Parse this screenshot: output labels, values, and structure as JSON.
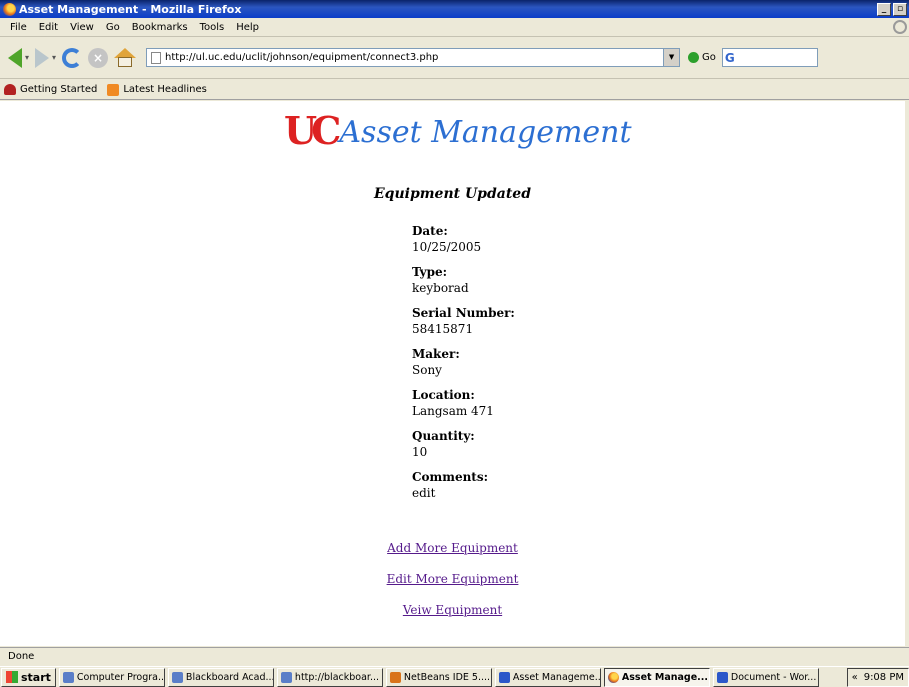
{
  "window": {
    "title": "Asset Management - Mozilla Firefox",
    "buttons": {
      "minimize": "_",
      "maximize": "▫",
      "close": "×"
    }
  },
  "menu": [
    "File",
    "Edit",
    "View",
    "Go",
    "Bookmarks",
    "Tools",
    "Help"
  ],
  "toolbar": {
    "url": "http://ul.uc.edu/uclit/johnson/equipment/connect3.php",
    "go_label": "Go",
    "search_placeholder": ""
  },
  "bookmarks": [
    "Getting Started",
    "Latest Headlines"
  ],
  "page": {
    "logo_mark": "UC",
    "logo_text": "Asset Management",
    "heading": "Equipment Updated",
    "fields": [
      {
        "label": "Date:",
        "value": "10/25/2005"
      },
      {
        "label": "Type:",
        "value": "keyborad"
      },
      {
        "label": "Serial Number:",
        "value": "58415871"
      },
      {
        "label": "Maker:",
        "value": "Sony"
      },
      {
        "label": "Location:",
        "value": "Langsam 471"
      },
      {
        "label": "Quantity:",
        "value": "10"
      },
      {
        "label": "Comments:",
        "value": "edit"
      }
    ],
    "links": [
      "Add More Equipment",
      "Edit More Equipment",
      "Veiw Equipment"
    ]
  },
  "status": "Done",
  "taskbar": {
    "start": "start",
    "tasks": [
      {
        "label": "Computer Progra...",
        "icon": "ie-icon",
        "active": false
      },
      {
        "label": "Blackboard Acad...",
        "icon": "ie-icon",
        "active": false
      },
      {
        "label": "http://blackboar...",
        "icon": "ie-icon",
        "active": false
      },
      {
        "label": "NetBeans IDE 5....",
        "icon": "netbeans-icon",
        "active": false
      },
      {
        "label": "Asset Manageme...",
        "icon": "word-icon",
        "active": false
      },
      {
        "label": "Asset Manage...",
        "icon": "firefox-icon",
        "active": true
      },
      {
        "label": "Document - Wor...",
        "icon": "word-icon",
        "active": false
      }
    ],
    "tray_chevron": "«",
    "clock": "9:08 PM"
  }
}
